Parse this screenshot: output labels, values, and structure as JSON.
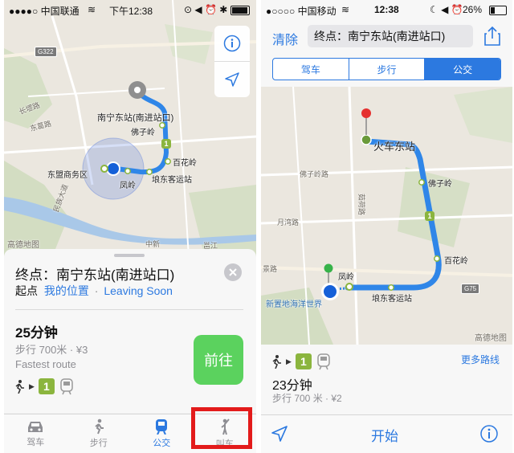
{
  "left": {
    "status": {
      "carrier": "●●●●○ 中国联通",
      "time": "下午12:38",
      "right": "⊙ ◀ ⏰ ✱"
    },
    "map": {
      "labels": {
        "station": "南宁东站(南进站口)",
        "foziling": "佛子岭",
        "baihualing": "百花岭",
        "dongmeng": "东盟商务区",
        "fengling": "凤岭",
        "kundong": "埌东客运站",
        "changgang": "长堽路",
        "dongge": "东葛路",
        "minzu": "民族大道",
        "zhongxin": "中新",
        "yongjiang": "邕江",
        "road": "邕江",
        "shield": "G322",
        "logo": "高德地图"
      },
      "metro_badge": "1"
    },
    "sheet": {
      "dest": "终点：南宁东站(南进站口)",
      "start_label": "起点",
      "start_value": "我的位置",
      "dot": "·",
      "leaving": "Leaving Soon",
      "duration": "25分钟",
      "detail": "步行 700米 · ¥3",
      "fastest": "Fastest route",
      "go_button": "前往",
      "metro_badge": "1"
    },
    "tabs": [
      {
        "label": "驾车"
      },
      {
        "label": "步行"
      },
      {
        "label": "公交"
      },
      {
        "label": "叫车"
      }
    ]
  },
  "right": {
    "status": {
      "carrier": "●○○○○ 中国移动",
      "time": "12:38",
      "battery": "26%"
    },
    "header": {
      "clear": "清除",
      "dest": "终点：南宁东站(南进站口)"
    },
    "segments": [
      "驾车",
      "步行",
      "公交"
    ],
    "map": {
      "labels": {
        "station": "火车东站",
        "foziling": "佛子岭",
        "fozilingroad": "佛子岭路",
        "baihualing": "百花岭",
        "fengling": "凤岭",
        "kundong": "埌东客运站",
        "yuecheng": "月湾路",
        "jingroad": "景路",
        "ocean": "新置地海洋世界",
        "yuntong": "茹荷路",
        "shield": "G75",
        "logo": "高德地图"
      },
      "metro_badge": "1"
    },
    "panel": {
      "more": "更多路线",
      "metro_badge": "1",
      "duration": "23分钟",
      "detail": "步行 700 米 · ¥2"
    },
    "bottom": {
      "start": "开始"
    }
  }
}
